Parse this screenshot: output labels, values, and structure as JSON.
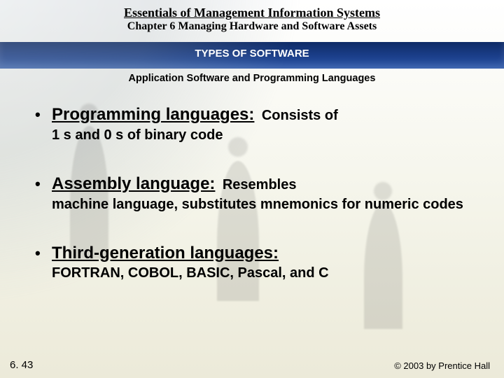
{
  "header": {
    "book_title": "Essentials of Management Information Systems",
    "chapter": "Chapter 6 Managing Hardware and Software Assets",
    "section": "TYPES OF SOFTWARE",
    "subsection": "Application Software and Programming Languages"
  },
  "bullets": [
    {
      "term": "Programming languages:",
      "desc_inline": "Consists of",
      "desc_block": "1 s and 0 s of binary code"
    },
    {
      "term": "Assembly language:",
      "desc_inline": "Resembles",
      "desc_block": "machine language, substitutes mnemonics for numeric codes"
    },
    {
      "term": "Third-generation languages:",
      "desc_inline": "",
      "desc_block": "FORTRAN, COBOL, BASIC, Pascal, and C"
    }
  ],
  "footer": {
    "slide_number": "6. 43",
    "copyright": "© 2003 by Prentice Hall"
  }
}
